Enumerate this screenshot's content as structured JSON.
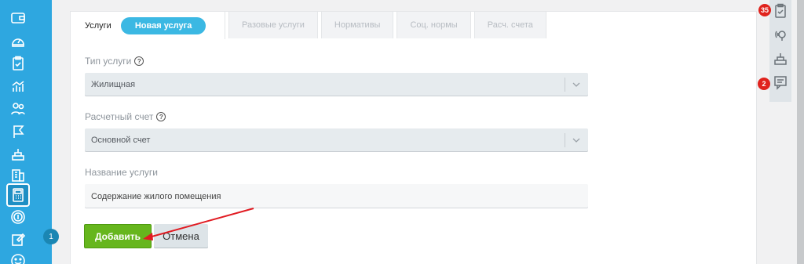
{
  "sidebar": {
    "icons": [
      "wallet-icon",
      "meter-icon",
      "clipboard-check-icon",
      "chart-icon",
      "users-icon",
      "flag-icon",
      "inbox-icon",
      "building-icon",
      "calculator-icon",
      "payment-icon",
      "edit-icon",
      "smile-icon"
    ],
    "active_index": 8,
    "step_badge": "1"
  },
  "tabs": [
    {
      "label": "Услуги",
      "active": true
    },
    {
      "label": "Разовые услуги"
    },
    {
      "label": "Нормативы"
    },
    {
      "label": "Соц. нормы"
    },
    {
      "label": "Расч. счета"
    }
  ],
  "new_service_button": "Новая услуга",
  "form": {
    "service_type_label": "Тип услуги",
    "service_type_value": "Жилищная",
    "account_label": "Расчетный счет",
    "account_value": "Основной счет",
    "name_label": "Название услуги",
    "name_value": "Содержание жилого помещения",
    "add_button": "Добавить",
    "cancel_button": "Отмена"
  },
  "right_panel": {
    "tasks_badge": "35",
    "messages_badge": "2"
  },
  "colors": {
    "sidebar": "#2ea7e0",
    "accent_pill": "#3bb8e3",
    "add_button": "#66b61d",
    "annotation_arrow": "#e11b22",
    "badge_red": "#e0231d"
  }
}
